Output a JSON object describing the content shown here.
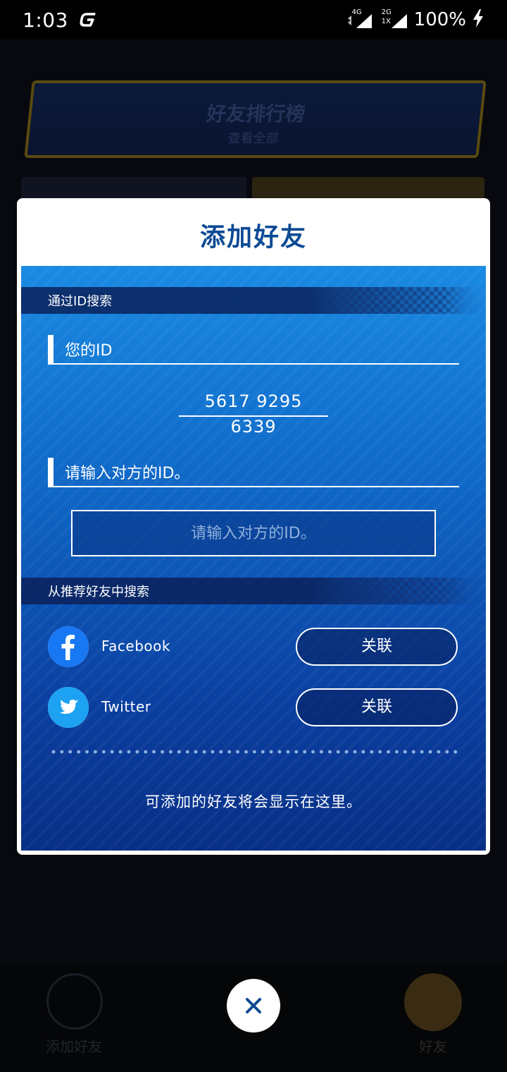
{
  "status_bar": {
    "time": "1:03",
    "network_1": "4G",
    "network_2": "2G",
    "network_2_sub": "1X",
    "battery": "100%"
  },
  "background": {
    "banner_title": "好友排行榜",
    "banner_subtitle": "查看全部",
    "left_button_label": "添加好友",
    "right_button_label": "好友"
  },
  "modal": {
    "title": "添加好友",
    "search_by_id_header": "通过ID搜索",
    "your_id_label": "您的ID",
    "your_id_value": "5617  9295  6339",
    "enter_id_label": "请输入对方的ID。",
    "id_input": {
      "placeholder": "请输入对方的ID。",
      "value": ""
    },
    "recommended_header": "从推荐好友中搜索",
    "social_accounts": [
      {
        "name": "Facebook",
        "icon": "facebook-icon",
        "color": "#1877f2",
        "button_label": "关联"
      },
      {
        "name": "Twitter",
        "icon": "twitter-icon",
        "color": "#1da1f2",
        "button_label": "关联"
      }
    ],
    "empty_message": "可添加的好友将会显示在这里。"
  },
  "close_button": {
    "icon": "close-icon",
    "color": "#0d4a94"
  }
}
